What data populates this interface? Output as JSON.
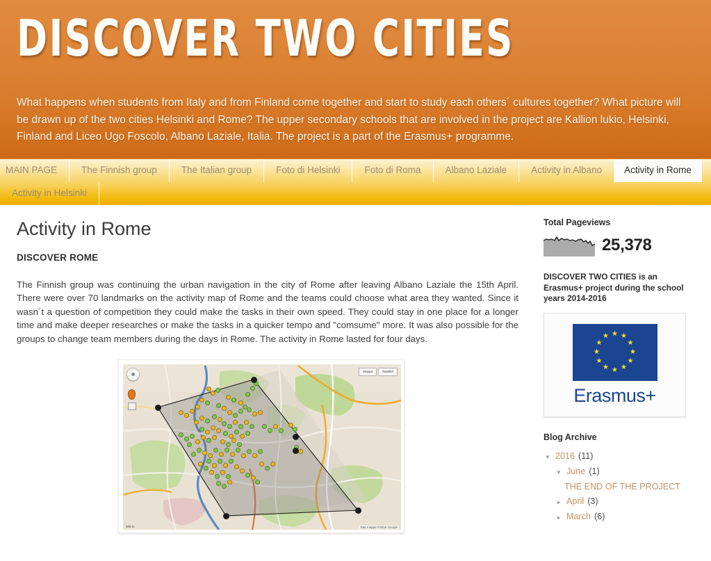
{
  "header": {
    "title": "DISCOVER TWO CITIES",
    "description": "What happens when students from Italy and from Finland come together and start to study each others´ cultures together? What picture will be drawn up of the two cities Helsinki and Rome? The upper secondary schools that are involved in the project are Kallion lukio, Helsinki, Finland and Liceo Ugo Foscolo, Albano Laziale, Italia. The project is a part of the Erasmus+ programme.",
    "bg_gradient_top": "#e08b3e",
    "bg_gradient_bottom": "#cb6a16",
    "title_color": "#fdfcf8"
  },
  "nav": {
    "bg_gradient_top": "#fdf3d4",
    "bg_gradient_bottom": "#efae00",
    "link_color": "#9b8c72",
    "active_bg": "#fbfbfa",
    "items": [
      {
        "label": "MAIN PAGE",
        "active": false
      },
      {
        "label": "The Finnish group",
        "active": false
      },
      {
        "label": "The Italian group",
        "active": false
      },
      {
        "label": "Foto di Helsinki",
        "active": false
      },
      {
        "label": "Foto di Roma",
        "active": false
      },
      {
        "label": "Albano Laziale",
        "active": false
      },
      {
        "label": "Activity in Albano",
        "active": false
      },
      {
        "label": "Activity in Rome",
        "active": true
      },
      {
        "label": "Activity in Helsinki",
        "active": false
      }
    ]
  },
  "post": {
    "title": "Activity in Rome",
    "subhead": "DISCOVER ROME",
    "body": "The Finnish group was continuing the urban navigation in the city of Rome after leaving Albano Laziale the 15th April. There were over 70 landmarks on the activity map of Rome and the teams could choose what area they wanted. Since it wasn´t a question of competition they could make the tasks in their own speed. They could stay in one place for a longer time and make deeper researches or make the tasks in a quicker tempo and \"comsume\" more. It was also possible for the groups to change team members during the days in Rome. The activity in Rome lasted for four days."
  },
  "map": {
    "type_buttons": [
      "Mappa",
      "Satellite"
    ],
    "attribution": "Dati mappa ©2016 Google",
    "scale_label": "500 m",
    "pan_control_icon": "compass-pan-icon",
    "marker_tool_icon": "map-pin-icon",
    "ruler_tool_icon": "ruler-icon",
    "landmark_count_note": "over 70 landmarks"
  },
  "sidebar": {
    "pageviews": {
      "heading": "Total Pageviews",
      "count": "25,378",
      "sparkline_color": "#ababab"
    },
    "project_note": "DISCOVER TWO CITIES is an Erasmus+ project during the school years 2014-2016",
    "erasmus": {
      "wordmark": "Erasmus+",
      "flag_color": "#1b4591",
      "star_color": "#f5e02c",
      "star_count": 12
    },
    "archive": {
      "heading": "Blog Archive",
      "link_color": "#c29163",
      "rows": [
        {
          "level": 1,
          "toggle": "▼",
          "label": "2016",
          "count": "(11)",
          "is_post": false
        },
        {
          "level": 2,
          "toggle": "▼",
          "label": "June",
          "count": "(1)",
          "is_post": false
        },
        {
          "level": 3,
          "toggle": "",
          "label": "THE END OF THE PROJECT",
          "count": "",
          "is_post": true
        },
        {
          "level": 2,
          "toggle": "►",
          "label": "April",
          "count": "(3)",
          "is_post": false
        },
        {
          "level": 2,
          "toggle": "►",
          "label": "March",
          "count": "(6)",
          "is_post": false
        }
      ]
    }
  }
}
